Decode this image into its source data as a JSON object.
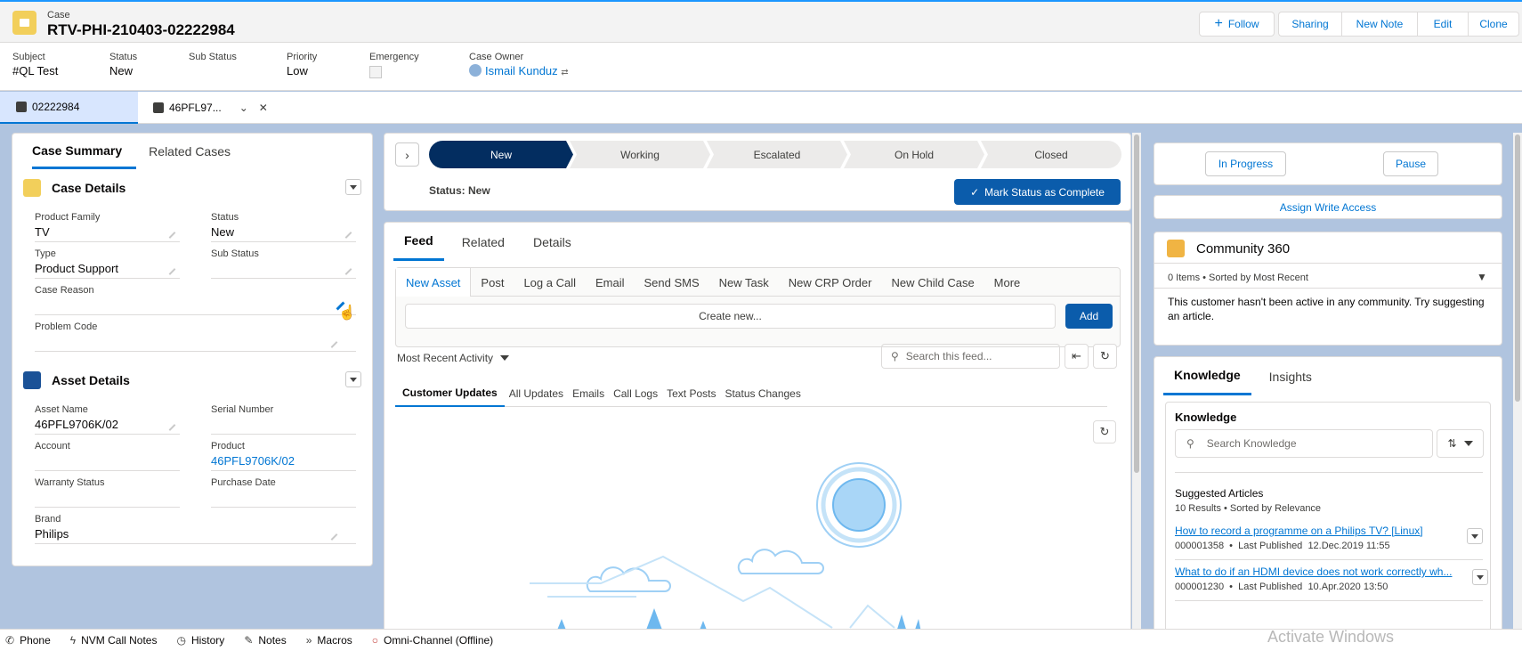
{
  "header": {
    "object_label": "Case",
    "title": "RTV-PHI-210403-02222984",
    "follow": "Follow",
    "actions": [
      "Sharing",
      "New Note",
      "Edit",
      "Clone"
    ]
  },
  "highlights": {
    "subject_label": "Subject",
    "subject": "#QL Test",
    "status_label": "Status",
    "status": "New",
    "sub_status_label": "Sub Status",
    "sub_status": "",
    "priority_label": "Priority",
    "priority": "Low",
    "emergency_label": "Emergency",
    "owner_label": "Case Owner",
    "owner": "Ismail Kunduz"
  },
  "subtabs": [
    {
      "label": "02222984"
    },
    {
      "label": "46PFL97..."
    }
  ],
  "left_panel": {
    "tabs": [
      "Case Summary",
      "Related Cases"
    ],
    "case_details_title": "Case Details",
    "fields": {
      "product_family_label": "Product Family",
      "product_family": "TV",
      "status_label": "Status",
      "status": "New",
      "type_label": "Type",
      "type": "Product Support",
      "sub_status_label": "Sub Status",
      "sub_status": "",
      "case_reason_label": "Case Reason",
      "case_reason": "",
      "problem_code_label": "Problem Code",
      "problem_code": ""
    },
    "asset_details_title": "Asset Details",
    "asset": {
      "asset_name_label": "Asset Name",
      "asset_name": "46PFL9706K/02",
      "serial_number_label": "Serial Number",
      "serial_number": "",
      "account_label": "Account",
      "account": "",
      "product_label": "Product",
      "product": "46PFL9706K/02",
      "warranty_status_label": "Warranty Status",
      "warranty_status": "",
      "purchase_date_label": "Purchase Date",
      "purchase_date": "",
      "brand_label": "Brand",
      "brand": "Philips"
    }
  },
  "path": {
    "stages": [
      "New",
      "Working",
      "Escalated",
      "On Hold",
      "Closed"
    ],
    "current_index": 0,
    "status_text": "Status: New",
    "mark_complete": "Mark Status as Complete"
  },
  "feed": {
    "tabs": [
      "Feed",
      "Related",
      "Details"
    ],
    "publisher_actions": [
      "New Asset",
      "Post",
      "Log a Call",
      "Email",
      "Send SMS",
      "New Task",
      "New CRP Order",
      "New Child Case",
      "More"
    ],
    "create_new": "Create new...",
    "add": "Add",
    "sort": "Most Recent Activity",
    "search_placeholder": "Search this feed...",
    "filters": [
      "Customer Updates",
      "All Updates",
      "Emails",
      "Call Logs",
      "Text Posts",
      "Status Changes"
    ]
  },
  "right_panel": {
    "in_progress": "In Progress",
    "pause": "Pause",
    "assign_write_access": "Assign Write Access",
    "community_title": "Community 360",
    "community_meta": "0 Items • Sorted by Most Recent",
    "community_empty": "This customer hasn't been active in any community. Try suggesting an article.",
    "knowledge_tabs": [
      "Knowledge",
      "Insights"
    ],
    "knowledge_title": "Knowledge",
    "search_placeholder": "Search Knowledge",
    "suggested_title": "Suggested Articles",
    "suggested_meta": "10 Results • Sorted by Relevance",
    "articles": [
      {
        "title": "How to record a programme on a Philips TV? [Linux]",
        "number": "000001358",
        "published": "Last Published",
        "date": "12.Dec.2019 11:55"
      },
      {
        "title": "What to do if an HDMI device does not work correctly wh...",
        "number": "000001230",
        "published": "Last Published",
        "date": "10.Apr.2020 13:50"
      }
    ]
  },
  "utility_bar": [
    "Phone",
    "NVM Call Notes",
    "History",
    "Notes",
    "Macros",
    "Omni-Channel (Offline)"
  ],
  "watermark": "Activate Windows",
  "colors": {
    "brand": "#0176d3",
    "path_current": "#032d60",
    "case_icon": "#f2cf5b",
    "asset_icon": "#1b5297",
    "community_icon": "#f0b443"
  }
}
